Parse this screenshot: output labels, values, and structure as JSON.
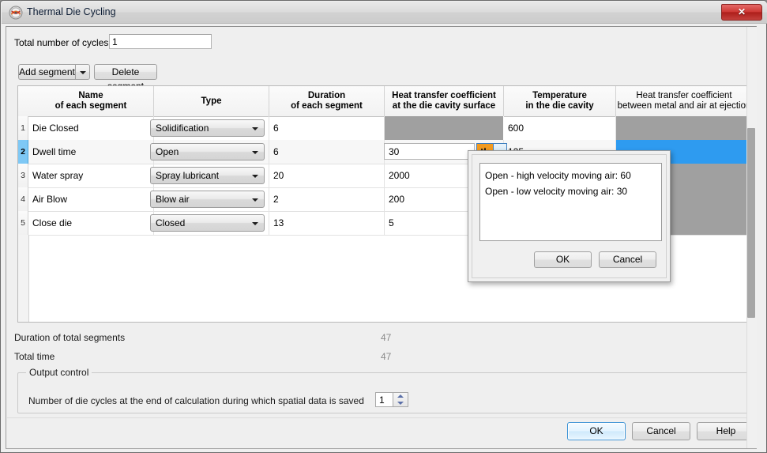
{
  "window": {
    "title": "Thermal Die Cycling",
    "icon": "app-gauge-icon",
    "close_label": "✕"
  },
  "top": {
    "cycles_label": "Total number of cycles",
    "cycles_value": "1",
    "add_segment_label": "Add segment",
    "delete_segment_label": "Delete segment"
  },
  "table": {
    "headers": [
      {
        "line1": "Name",
        "line2": "of each segment",
        "bold": true
      },
      {
        "line1": "Type",
        "line2": "",
        "bold": true
      },
      {
        "line1": "Duration",
        "line2": "of each segment",
        "bold": true
      },
      {
        "line1": "Heat transfer coefficient",
        "line2": "at the die cavity surface",
        "bold": true
      },
      {
        "line1": "Temperature",
        "line2": "in the die cavity",
        "bold": true
      },
      {
        "line1": "Heat transfer coefficient",
        "line2": "between metal and air at ejection",
        "bold": false
      }
    ],
    "rows": [
      {
        "index": "1",
        "name": "Die Closed",
        "type": "Solidification",
        "duration": "6",
        "htc_surface": "",
        "htc_surface_state": "disabled",
        "temperature": "600",
        "htc_ejection": "",
        "htc_ejection_state": "disabled",
        "selected": false
      },
      {
        "index": "2",
        "name": "Dwell time",
        "type": "Open",
        "duration": "6",
        "htc_surface": "30",
        "htc_surface_state": "editing",
        "temperature": "125",
        "htc_ejection": "",
        "htc_ejection_state": "selected",
        "selected": true
      },
      {
        "index": "3",
        "name": "Water spray",
        "type": "Spray lubricant",
        "duration": "20",
        "htc_surface": "2000",
        "htc_surface_state": "normal",
        "temperature": "",
        "htc_ejection": "",
        "htc_ejection_state": "disabled",
        "selected": false
      },
      {
        "index": "4",
        "name": "Air Blow",
        "type": "Blow air",
        "duration": "2",
        "htc_surface": "200",
        "htc_surface_state": "normal",
        "temperature": "",
        "htc_ejection": "",
        "htc_ejection_state": "disabled",
        "selected": false
      },
      {
        "index": "5",
        "name": "Close die",
        "type": "Closed",
        "duration": "13",
        "htc_surface": "5",
        "htc_surface_state": "normal",
        "temperature": "",
        "htc_ejection": "",
        "htc_ejection_state": "disabled",
        "selected": false
      }
    ]
  },
  "summary": {
    "duration_label": "Duration of total segments",
    "duration_value": "47",
    "total_time_label": "Total time",
    "total_time_value": "47"
  },
  "output_control": {
    "legend": "Output control",
    "spinner_label": "Number of die cycles at the end of calculation during which spatial data is saved",
    "spinner_value": "1"
  },
  "footer": {
    "ok_label": "OK",
    "cancel_label": "Cancel",
    "help_label": "Help"
  },
  "popup": {
    "options": [
      "Open - high velocity moving air: 60",
      "Open - low velocity moving air: 30"
    ],
    "ok_label": "OK",
    "cancel_label": "Cancel"
  },
  "colors": {
    "selection_blue": "#2e9bf0",
    "row_header_blue": "#7ec8f5",
    "disabled_gray": "#a0a0a0",
    "wave_orange": "#f29a1f",
    "close_red": "#cf3a36"
  }
}
